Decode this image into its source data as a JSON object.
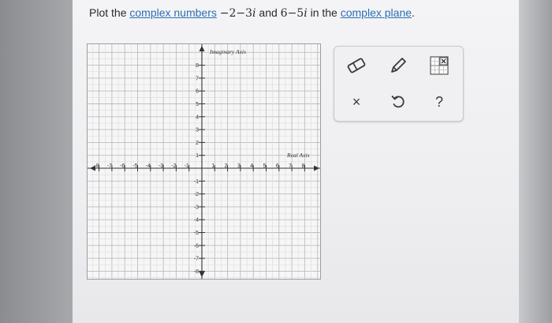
{
  "prompt": {
    "lead": "Plot the",
    "link1": "complex numbers",
    "z1": "−2−3",
    "i1": "i",
    "and": "and",
    "z2": "6−5",
    "i2": "i",
    "in_the": "in the",
    "link2": "complex plane",
    "period": "."
  },
  "graph": {
    "y_axis_label": "Imaginary Axis",
    "x_axis_label": "Real Axis",
    "x_ticks": [
      "-8",
      "-7",
      "-6",
      "-5",
      "-4",
      "-3",
      "-2",
      "-1",
      "1",
      "2",
      "3",
      "4",
      "5",
      "6",
      "7",
      "8"
    ],
    "y_ticks": [
      "8",
      "7",
      "6",
      "5",
      "4",
      "3",
      "2",
      "1",
      "-1",
      "-2",
      "-3",
      "-4",
      "-5",
      "-6",
      "-7",
      "-8"
    ]
  },
  "toolbar": {
    "eraser": "eraser-icon",
    "pencil": "pencil-icon",
    "grid_point": "point-grid-icon",
    "clear_label": "×",
    "undo_icon": "undo-icon",
    "help_label": "?"
  }
}
